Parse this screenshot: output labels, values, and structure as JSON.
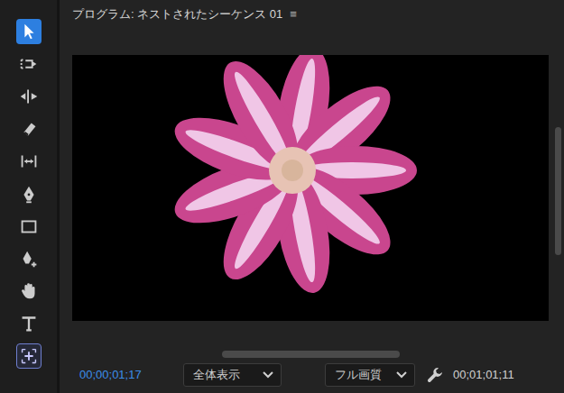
{
  "panel": {
    "title": "プログラム: ネストされたシーケンス 01",
    "menu": "≡"
  },
  "tools": [
    {
      "kind": "selection",
      "selected": true,
      "highlighted": false
    },
    {
      "kind": "trackselect",
      "selected": false,
      "highlighted": false
    },
    {
      "kind": "ripple",
      "selected": false,
      "highlighted": false
    },
    {
      "kind": "razor",
      "selected": false,
      "highlighted": false
    },
    {
      "kind": "slip",
      "selected": false,
      "highlighted": false
    },
    {
      "kind": "pen",
      "selected": false,
      "highlighted": false
    },
    {
      "kind": "rectangle",
      "selected": false,
      "highlighted": false
    },
    {
      "kind": "penplus",
      "selected": false,
      "highlighted": false
    },
    {
      "kind": "hand",
      "selected": false,
      "highlighted": false
    },
    {
      "kind": "type",
      "selected": false,
      "highlighted": false
    },
    {
      "kind": "transform",
      "selected": false,
      "highlighted": true
    }
  ],
  "footer": {
    "timecode": "00;00;01;17",
    "zoom": "全体表示",
    "quality": "フル画質",
    "duration": "00;01;01;11"
  }
}
